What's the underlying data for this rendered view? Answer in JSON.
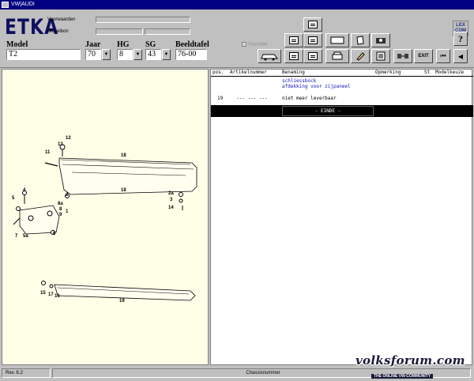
{
  "window": {
    "title": "VW|AUDI"
  },
  "header": {
    "logo": "ETKA",
    "voorwaarden_label": "Voorwaarden",
    "bestelbon_label": "Bestelbon",
    "checkbox_label": "Voorraad",
    "lexcom": "LEX\nCOM",
    "help_label": "?"
  },
  "selectors": {
    "model": {
      "label": "Model",
      "value": "T2"
    },
    "jaar": {
      "label": "Jaar",
      "value": "70"
    },
    "hg": {
      "label": "HG",
      "value": "8"
    },
    "sg": {
      "label": "SG",
      "value": "43"
    },
    "beeldtafel": {
      "label": "Beeldtafel",
      "value": "76-00"
    },
    "dropdown_glyph": "▼"
  },
  "toolbar": {
    "exit_label": "EXIT",
    "first_glyph": "⏮",
    "prev_glyph": "◀",
    "left_glyph": "◀",
    "right_glyph": "▶"
  },
  "parts_table": {
    "headers": {
      "pos": "pos.",
      "artikel": "Artikelnummer",
      "benaming": "Benaming",
      "opmerking": "Opmerking",
      "st": "St",
      "modelkeuze": "Modelkeuze"
    },
    "group_title_1": "schliessbock",
    "group_title_2": "afdekking voor zijpaneel",
    "rows": [
      {
        "pos": "19",
        "artikel": "--- --- ---",
        "benaming": "niet meer leverbaar"
      }
    ],
    "end_label": "- EINDE -"
  },
  "diagram": {
    "callouts": [
      "12",
      "13",
      "11",
      "18",
      "18",
      "2",
      "2a",
      "3",
      "14",
      "4",
      "5",
      "8a",
      "8",
      "9",
      "1",
      "6",
      "7",
      "5a",
      "15",
      "17",
      "16",
      "19"
    ]
  },
  "status": {
    "rev": "Rev. 6.2",
    "chassis": "Chassisnummer"
  },
  "watermark": {
    "main": "volksforum.com",
    "sub": "THE ONLINE VW-COMMUNITY"
  }
}
